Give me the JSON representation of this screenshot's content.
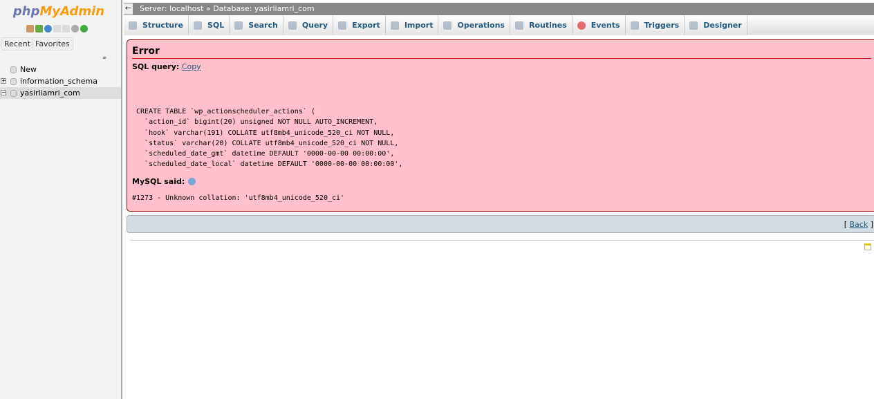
{
  "sidebar": {
    "logo_php": "php",
    "logo_rest": "MyAdmin",
    "recent": "Recent",
    "favorites": "Favorites",
    "tree": [
      {
        "label": "New"
      },
      {
        "label": "information_schema",
        "toggle": "+"
      },
      {
        "label": "yasirliamri_com",
        "toggle": "−",
        "selected": true
      }
    ]
  },
  "topbar": {
    "server": "Server: localhost",
    "sep": "»",
    "database": "Database: yasirliamri_com"
  },
  "tabs": [
    {
      "label": "Structure"
    },
    {
      "label": "SQL"
    },
    {
      "label": "Search"
    },
    {
      "label": "Query"
    },
    {
      "label": "Export"
    },
    {
      "label": "Import"
    },
    {
      "label": "Operations"
    },
    {
      "label": "Routines"
    },
    {
      "label": "Events"
    },
    {
      "label": "Triggers"
    },
    {
      "label": "Designer"
    }
  ],
  "error": {
    "title": "Error",
    "sql_query_label": "SQL query:",
    "copy": "Copy",
    "query": " CREATE TABLE `wp_actionscheduler_actions` (\n   `action_id` bigint(20) unsigned NOT NULL AUTO_INCREMENT,\n   `hook` varchar(191) COLLATE utf8mb4_unicode_520_ci NOT NULL,\n   `status` varchar(20) COLLATE utf8mb4_unicode_520_ci NOT NULL,\n   `scheduled_date_gmt` datetime DEFAULT '0000-00-00 00:00:00',\n   `scheduled_date_local` datetime DEFAULT '0000-00-00 00:00:00',",
    "mysql_said": "MySQL said:",
    "message": "#1273 - Unknown collation: 'utf8mb4_unicode_520_ci'"
  },
  "backbar": {
    "open": "[ ",
    "back": "Back",
    "close": " ]"
  }
}
